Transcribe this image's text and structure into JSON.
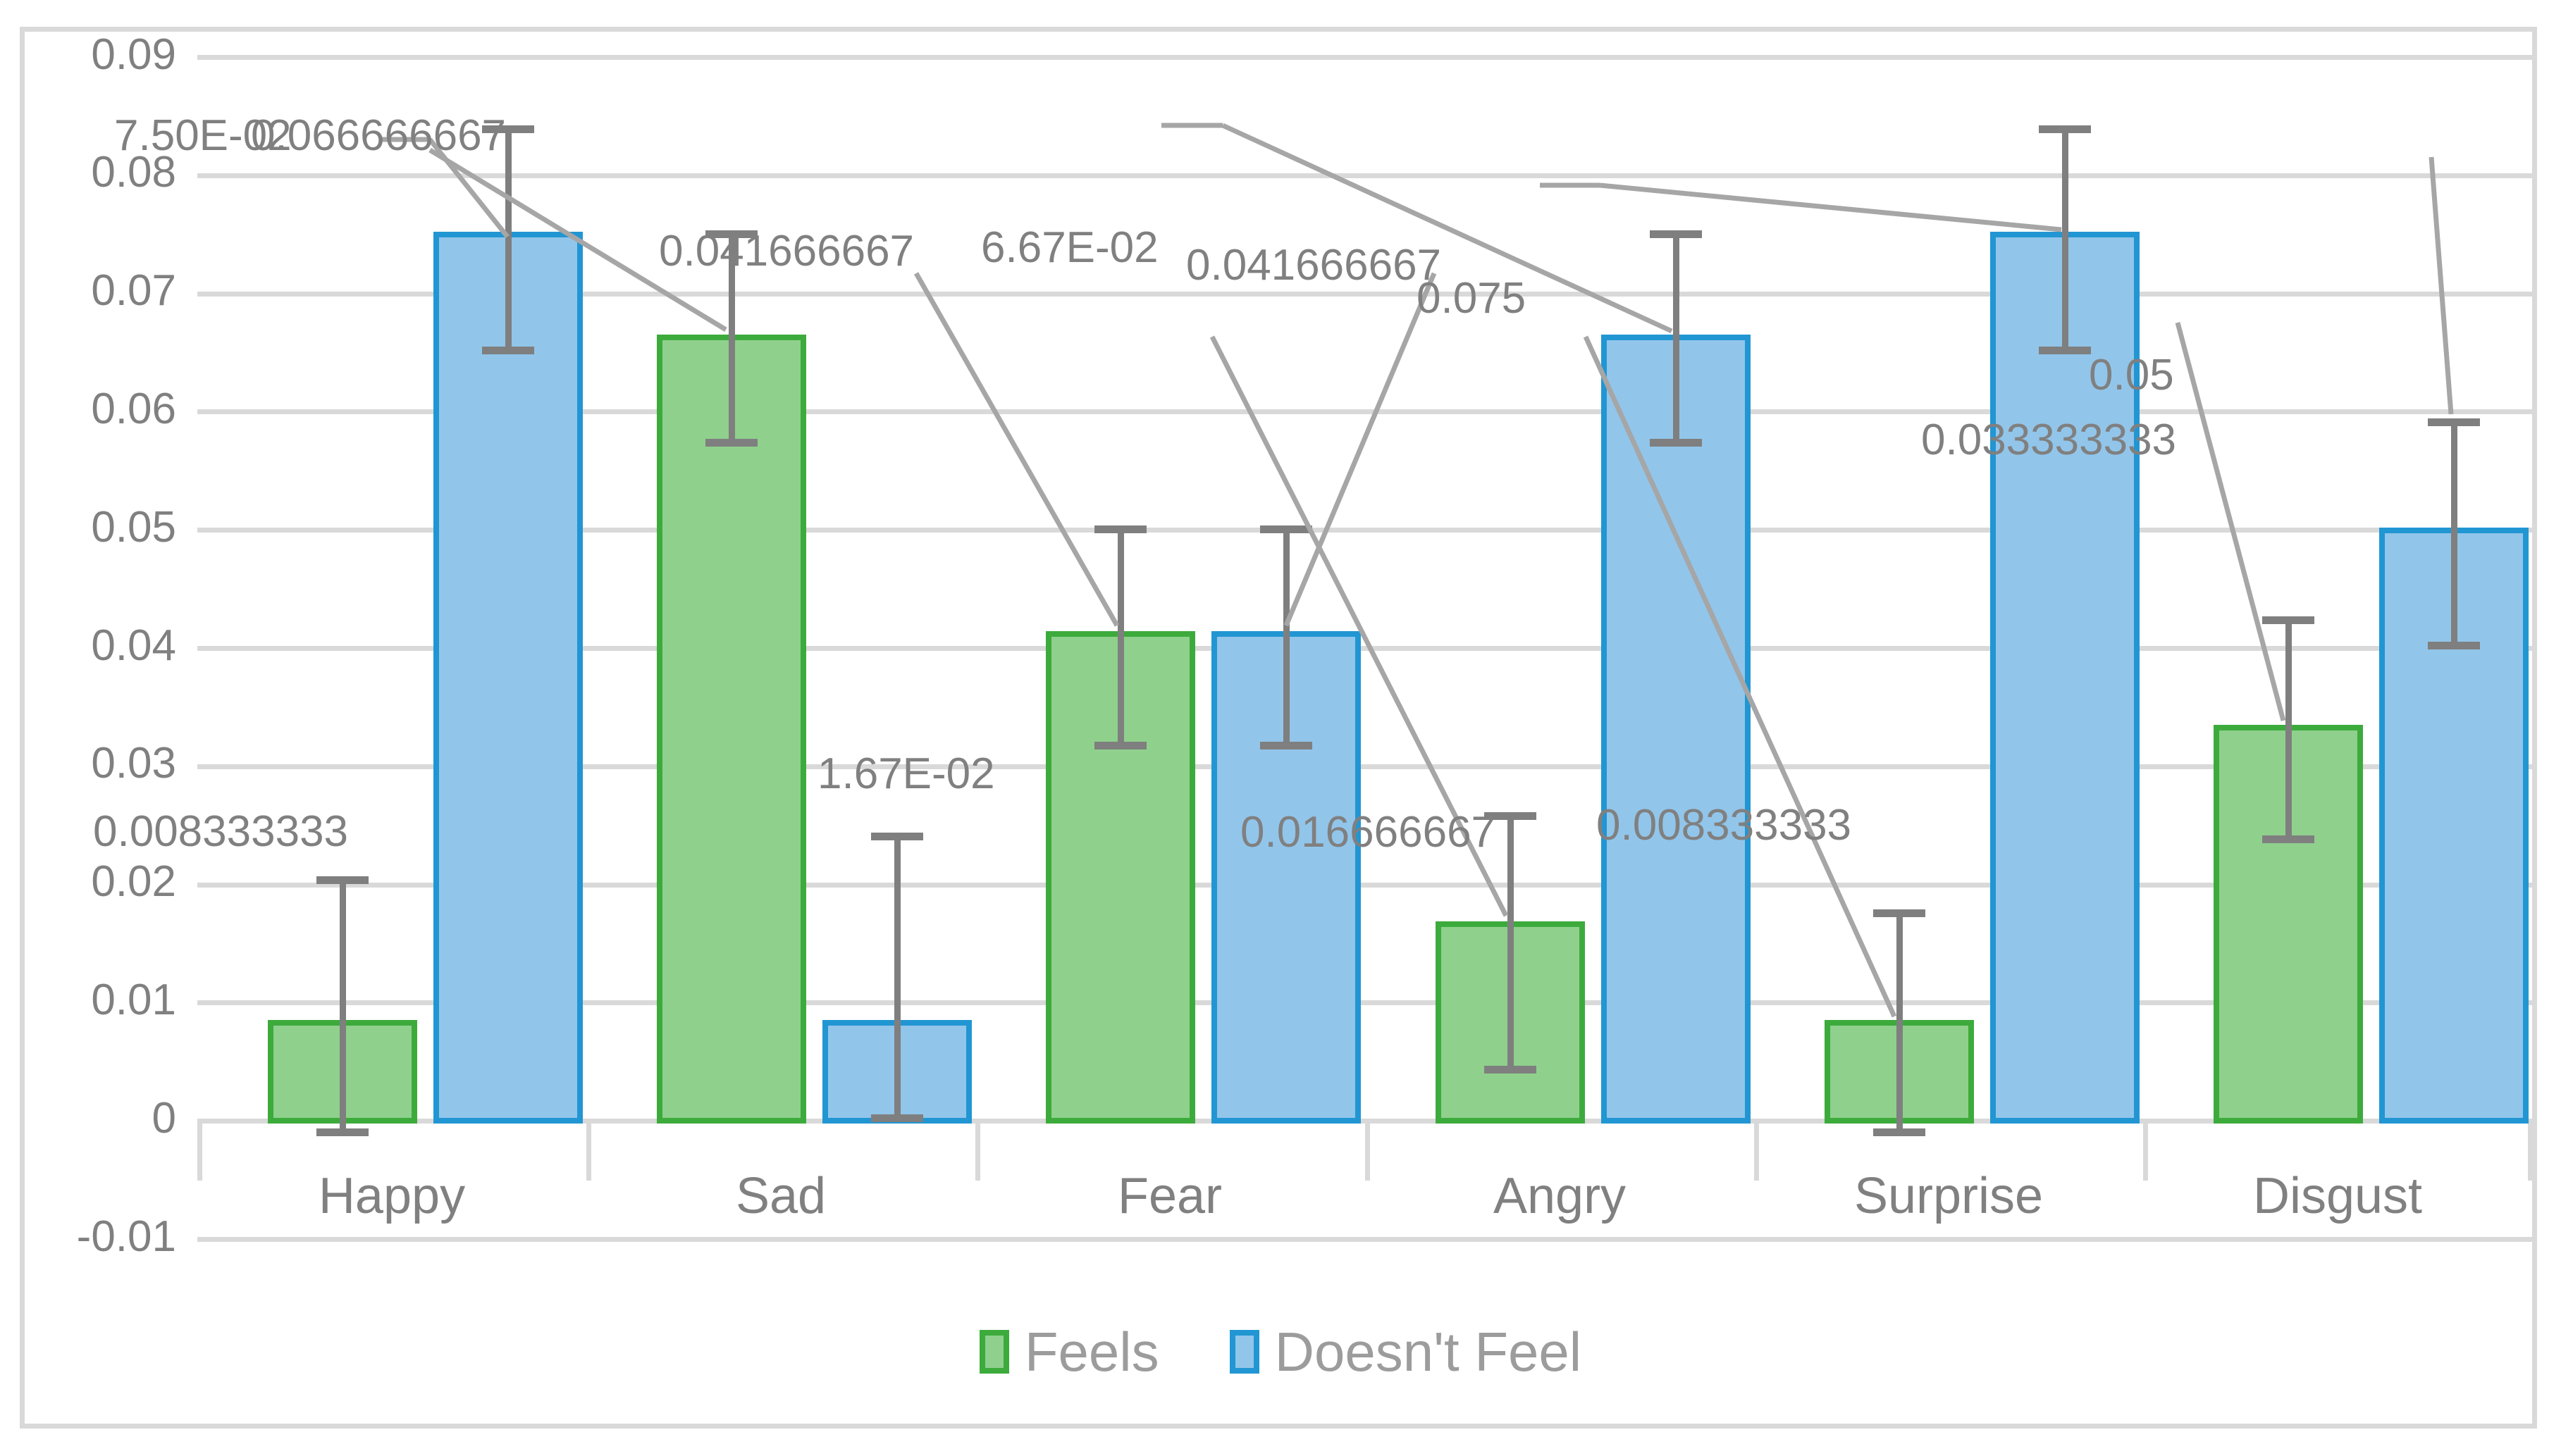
{
  "chart_data": {
    "type": "bar",
    "title": "",
    "subtitle": "",
    "xlabel": "",
    "ylabel": "",
    "categories": [
      "Happy",
      "Sad",
      "Fear",
      "Angry",
      "Surprise",
      "Disgust"
    ],
    "ylim": [
      -0.01,
      0.09
    ],
    "yticks": [
      "0.09",
      "0.08",
      "0.07",
      "0.06",
      "0.05",
      "0.04",
      "0.03",
      "0.02",
      "0.01",
      "0",
      "-0.01"
    ],
    "ytick_values": [
      0.09,
      0.08,
      0.07,
      0.06,
      0.05,
      0.04,
      0.03,
      0.02,
      0.01,
      0,
      -0.01
    ],
    "grid": true,
    "legend_position": "bottom",
    "series": [
      {
        "name": "Feels",
        "color": "#8fd08d",
        "border_color": "#3cab3c",
        "values": [
          0.008333333,
          0.066666667,
          0.041666667,
          0.016666667,
          0.008333333,
          0.033333333
        ],
        "labels": [
          "0.008333333",
          "0.066666667",
          "0.041666667",
          "0.016666667",
          "0.008333333",
          "0.033333333"
        ],
        "error_upper": [
          0.0205,
          0.0755,
          0.0507,
          0.0259,
          0.0177,
          0.0425
        ],
        "error_lower": [
          -0.0008,
          0.0573,
          0.0324,
          0.0073,
          -0.0008,
          0.024
        ]
      },
      {
        "name": "Doesn't Feel",
        "color": "#92c5ea",
        "border_color": "#2196d3",
        "values": [
          0.075,
          0.016666667,
          0.041666667,
          0.066666667,
          0.075,
          0.05
        ],
        "labels": [
          "7.50E-02",
          "1.67E-02",
          "0.041666667",
          "6.67E-02",
          "0.075",
          "0.05"
        ],
        "error_upper": [
          0.0842,
          0.0242,
          0.0507,
          0.0755,
          0.0842,
          0.0593
        ],
        "error_lower": [
          0.0655,
          0.0073,
          0.0324,
          0.0573,
          0.0655,
          0.0405
        ]
      }
    ]
  },
  "legend": {
    "items": [
      {
        "label": "Feels"
      },
      {
        "label": "Doesn't Feel"
      }
    ]
  },
  "axis": {
    "y_labels": [
      "0.09",
      "0.08",
      "0.07",
      "0.06",
      "0.05",
      "0.04",
      "0.03",
      "0.02",
      "0.01",
      "0",
      "-0.01"
    ],
    "x_labels": [
      "Happy",
      "Sad",
      "Fear",
      "Angry",
      "Surprise",
      "Disgust"
    ]
  },
  "colors": {
    "feels_fill": "#8fd08d",
    "feels_border": "#3cab3c",
    "nofeels_fill": "#92c5ea",
    "nofeels_border": "#2196d3",
    "grid": "#d9d9d9",
    "text": "#808080",
    "error_bar": "#7f7f7f",
    "leader": "#a6a6a6"
  }
}
